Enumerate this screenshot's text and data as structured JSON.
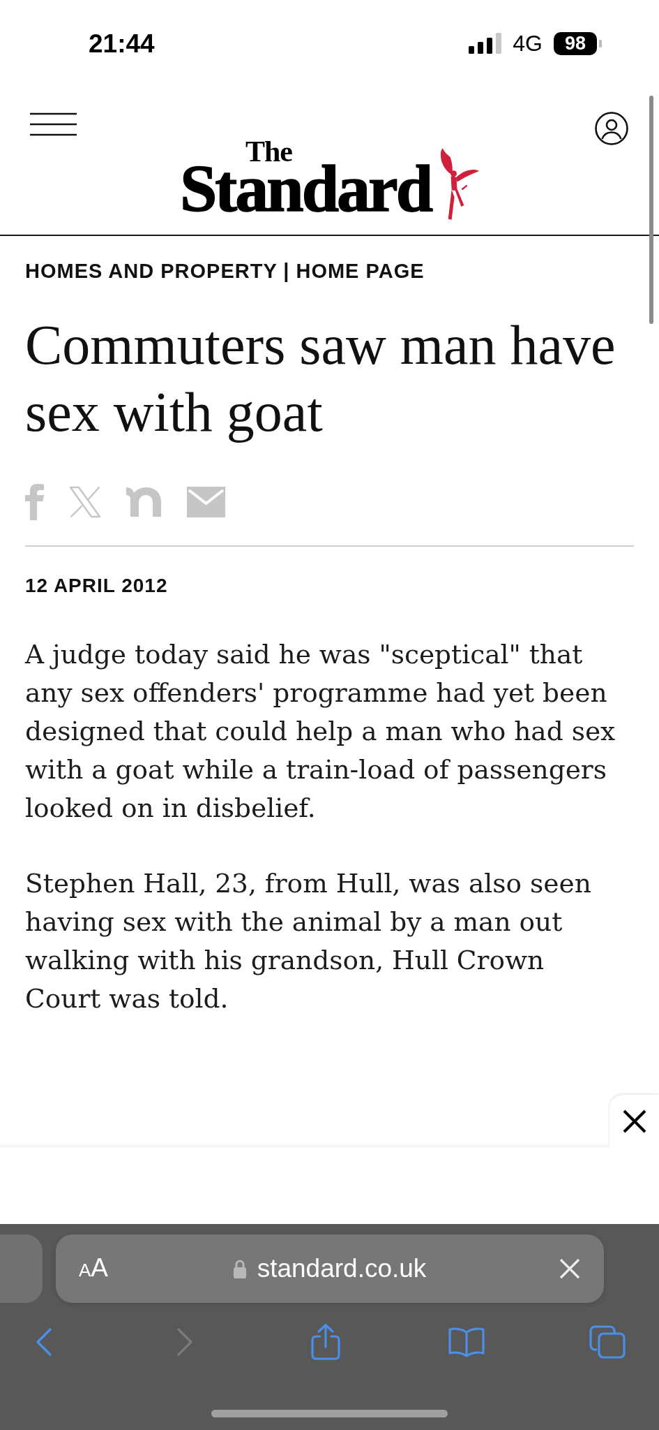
{
  "status_bar": {
    "time": "21:44",
    "network": "4G",
    "battery": "98"
  },
  "header": {
    "logo": {
      "line_1": "The",
      "line_2": "Standard"
    }
  },
  "article": {
    "section": "HOMES AND PROPERTY | HOME PAGE",
    "headline": "Commuters saw man have sex with goat",
    "share_buttons": [
      {
        "kind": "facebook"
      },
      {
        "kind": "x"
      },
      {
        "kind": "nextdoor"
      },
      {
        "kind": "email"
      }
    ],
    "date": "12 APRIL 2012",
    "paragraphs": [
      "A judge today said he was \"sceptical\" that any sex offenders' programme had yet been designed that could help a man who had sex with a goat while a train-load of passengers looked on in disbelief.",
      "Stephen Hall, 23, from Hull, was also seen having sex with the animal by a man out walking with his grandson, Hull Crown Court was told."
    ]
  },
  "browser": {
    "text_size_button": "AA",
    "url": "standard.co.uk",
    "toolbar": [
      {
        "kind": "back",
        "disabled": false
      },
      {
        "kind": "forward",
        "disabled": true
      },
      {
        "kind": "share",
        "disabled": false
      },
      {
        "kind": "bookmarks",
        "disabled": false
      },
      {
        "kind": "tabs",
        "disabled": false
      }
    ]
  }
}
